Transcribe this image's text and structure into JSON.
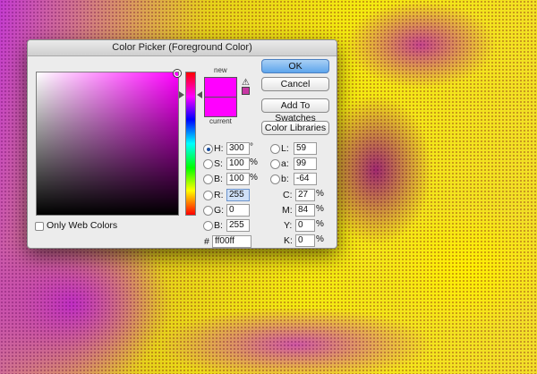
{
  "dialog": {
    "title": "Color Picker (Foreground Color)",
    "current_color": "#ff00ff",
    "new_color": "#ff00ff",
    "swatch_new_label": "new",
    "swatch_current_label": "current"
  },
  "buttons": {
    "ok": "OK",
    "cancel": "Cancel",
    "add_to_swatches": "Add To Swatches",
    "color_libraries": "Color Libraries"
  },
  "hsb": {
    "h_label": "H:",
    "h_value": "300",
    "h_unit": "°",
    "s_label": "S:",
    "s_value": "100",
    "s_unit": "%",
    "b_label": "B:",
    "b_value": "100",
    "b_unit": "%",
    "selected": "H"
  },
  "rgb": {
    "r_label": "R:",
    "r_value": "255",
    "g_label": "G:",
    "g_value": "0",
    "b_label": "B:",
    "b_value": "255"
  },
  "lab": {
    "l_label": "L:",
    "l_value": "59",
    "a_label": "a:",
    "a_value": "99",
    "b_label": "b:",
    "b_value": "-64"
  },
  "cmyk": {
    "c_label": "C:",
    "c_value": "27",
    "m_label": "M:",
    "m_value": "84",
    "y_label": "Y:",
    "y_value": "0",
    "k_label": "K:",
    "k_value": "0",
    "unit": "%"
  },
  "hex": {
    "label": "#",
    "value": "ff00ff"
  },
  "only_web_colors": {
    "label": "Only Web Colors",
    "checked": false
  },
  "icons": {
    "gamut_warning": "warning-triangle-icon",
    "web_safe": "web-cube-icon"
  }
}
